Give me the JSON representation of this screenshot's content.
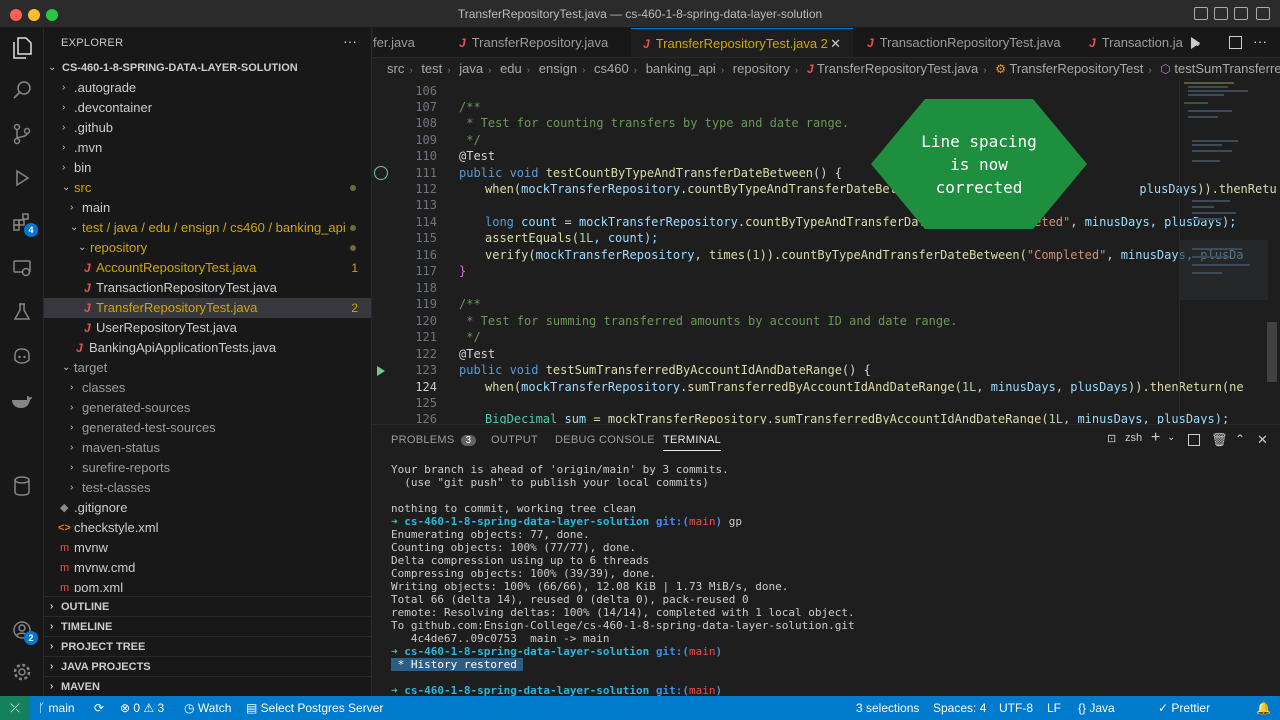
{
  "window": {
    "title": "TransferRepositoryTest.java — cs-460-1-8-spring-data-layer-solution"
  },
  "explorer": {
    "title": "EXPLORER",
    "more": "···",
    "root": "CS-460-1-8-SPRING-DATA-LAYER-SOLUTION",
    "items": [
      {
        "label": ".autograde"
      },
      {
        "label": ".devcontainer"
      },
      {
        "label": ".github"
      },
      {
        "label": ".mvn"
      },
      {
        "label": "bin"
      },
      {
        "label": "src"
      },
      {
        "label": "main"
      },
      {
        "label": "test / java / edu / ensign / cs460 / banking_api"
      },
      {
        "label": "repository"
      },
      {
        "label": "AccountRepositoryTest.java",
        "count": "1"
      },
      {
        "label": "TransactionRepositoryTest.java"
      },
      {
        "label": "TransferRepositoryTest.java",
        "count": "2"
      },
      {
        "label": "UserRepositoryTest.java"
      },
      {
        "label": "BankingApiApplicationTests.java"
      },
      {
        "label": "target"
      },
      {
        "label": "classes"
      },
      {
        "label": "generated-sources"
      },
      {
        "label": "generated-test-sources"
      },
      {
        "label": "maven-status"
      },
      {
        "label": "surefire-reports"
      },
      {
        "label": "test-classes"
      },
      {
        "label": ".gitignore"
      },
      {
        "label": "checkstyle.xml"
      },
      {
        "label": "mvnw"
      },
      {
        "label": "mvnw.cmd"
      },
      {
        "label": "pom.xml"
      }
    ],
    "sections": [
      "OUTLINE",
      "TIMELINE",
      "PROJECT TREE",
      "JAVA PROJECTS",
      "MAVEN"
    ]
  },
  "activity": {
    "extensions_badge": "4",
    "accounts_badge": "2"
  },
  "tabs": [
    {
      "label": "fer.java"
    },
    {
      "label": "TransferRepository.java"
    },
    {
      "label": "TransferRepositoryTest.java 2"
    },
    {
      "label": "TransactionRepositoryTest.java"
    },
    {
      "label": "Transaction.ja"
    }
  ],
  "breadcrumb": [
    "src",
    "test",
    "java",
    "edu",
    "ensign",
    "cs460",
    "banking_api",
    "repository",
    "TransferRepositoryTest.java",
    "TransferRepositoryTest",
    "testSumTransferredByAc"
  ],
  "code": {
    "line_numbers": [
      "106",
      "107",
      "108",
      "109",
      "110",
      "111",
      "112",
      "113",
      "114",
      "115",
      "116",
      "117",
      "118",
      "119",
      "120",
      "121",
      "122",
      "123",
      "124",
      "125",
      "126"
    ],
    "lines": {
      "l107": "/**",
      "l108": " * Test for counting transfers by type and date range.",
      "l109": " */",
      "l110": "@Test",
      "l111a": "public ",
      "l111b": "void ",
      "l111c": "testCountByTypeAndTransferDateBetween",
      "l111d": "() {",
      "l112a": "when(",
      "l112b": "mockTransferRepository",
      "l112c": ".countByTypeAndTransferDateBetween(",
      "l112d": "\"C",
      "l112e": "plusDays",
      "l112f": ")).thenRetu",
      "l114a": "long ",
      "l114b": "count",
      "l114c": " = ",
      "l114d": "mockTransferRepository",
      "l114e": ".countByTypeAndTransferDateBetween(",
      "l114f": "\"Completed\"",
      "l114g": ", minusDays, plusDays);",
      "l115a": "assertEquals(",
      "l115b": "1L",
      "l115c": ", count);",
      "l116a": "verify(",
      "l116b": "mockTransferRepository",
      "l116c": ", times(",
      "l116d": "1",
      "l116e": ")).countByTypeAndTransferDateBetween(",
      "l116f": "\"Completed\"",
      "l116g": ", minusDays, plusDa",
      "l117": "}",
      "l119": "/**",
      "l120": " * Test for summing transferred amounts by account ID and date range.",
      "l121": " */",
      "l122": "@Test",
      "l123a": "public ",
      "l123b": "void ",
      "l123c": "testSumTransferredByAccountIdAndDateRange",
      "l123d": "() {",
      "l124a": "when(",
      "l124b": "mockTransferRepository",
      "l124c": ".sumTransferredByAccountIdAndDateRange(",
      "l124d": "1L",
      "l124e": ", minusDays, plusDays",
      "l124f": ")).thenReturn(ne",
      "l126a": "BigDecimal ",
      "l126b": "sum",
      "l126c": " = mockTransferRepository.sumTransferredByAccountIdAndDateRange(",
      "l126d": "1L",
      "l126e": ", minusDays, plusDays);"
    }
  },
  "callout": {
    "text": "Line spacing is now corrected"
  },
  "panel": {
    "tabs": [
      "PROBLEMS",
      "OUTPUT",
      "DEBUG CONSOLE",
      "TERMINAL"
    ],
    "problems_count": "3",
    "shell": "zsh",
    "terminal": [
      "Your branch is ahead of 'origin/main' by 3 commits.",
      "  (use \"git push\" to publish your local commits)",
      "",
      "nothing to commit, working tree clean",
      "PROMPT:gp",
      "Enumerating objects: 77, done.",
      "Counting objects: 100% (77/77), done.",
      "Delta compression using up to 6 threads",
      "Compressing objects: 100% (39/39), done.",
      "Writing objects: 100% (66/66), 12.08 KiB | 1.73 MiB/s, done.",
      "Total 66 (delta 14), reused 0 (delta 0), pack-reused 0",
      "remote: Resolving deltas: 100% (14/14), completed with 1 local object.",
      "To github.com:Ensign-College/cs-460-1-8-spring-data-layer-solution.git",
      "   4c4de67..09c0753  main -> main",
      "PROMPT:",
      "HIST: History restored",
      "",
      "PROMPT:"
    ],
    "prompt_arrow": "➜",
    "prompt_dir": "cs-460-1-8-spring-data-layer-solution",
    "prompt_git": "git:(",
    "prompt_branch": "main",
    "prompt_close": ")"
  },
  "status": {
    "branch": "main",
    "problems": "0",
    "warnings": "3",
    "watch": "Watch",
    "postgres": "Select Postgres Server",
    "selections": "3 selections",
    "spaces": "Spaces: 4",
    "encoding": "UTF-8",
    "eol": "LF",
    "language": "Java",
    "prettier": "Prettier"
  },
  "colors": {
    "accent": "#007acc",
    "modified": "#cca700",
    "callout": "#1e8f3f"
  }
}
